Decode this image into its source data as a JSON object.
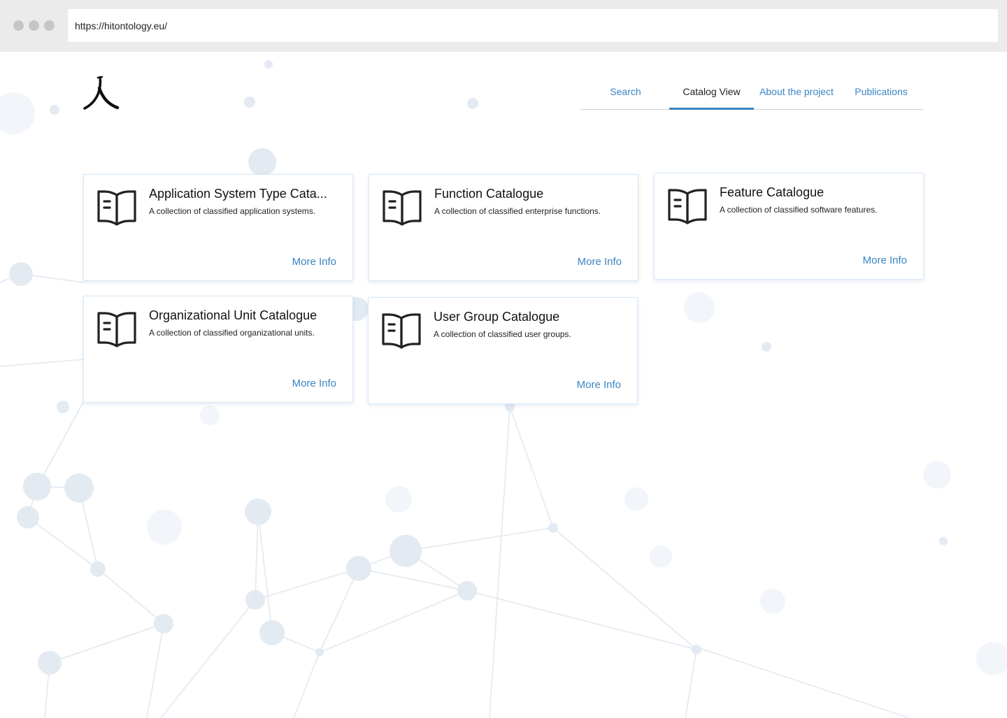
{
  "browser": {
    "url": "https://hitontology.eu/"
  },
  "header": {
    "logo_glyph": "人"
  },
  "nav": {
    "items": [
      {
        "label": "Search",
        "active": false
      },
      {
        "label": "Catalog View",
        "active": true
      },
      {
        "label": "About the project",
        "active": false
      },
      {
        "label": "Publications",
        "active": false
      }
    ]
  },
  "cards": [
    {
      "title": "Application System Type Cata...",
      "description": "A collection of classified application systems.",
      "link": "More Info",
      "icon": "open-book-icon"
    },
    {
      "title": "Function Catalogue",
      "description": "A collection of classified enterprise functions.",
      "link": "More Info",
      "icon": "open-book-icon"
    },
    {
      "title": "Feature Catalogue",
      "description": "A collection of classified software features.",
      "link": "More Info",
      "icon": "open-book-icon"
    },
    {
      "title": "Organizational Unit Catalogue",
      "description": "A collection of classified organizational units.",
      "link": "More Info",
      "icon": "open-book-icon"
    },
    {
      "title": "User Group Catalogue",
      "description": "A collection of classified user groups.",
      "link": "More Info",
      "icon": "open-book-icon"
    }
  ],
  "colors": {
    "accent": "#3a85c4",
    "card_border": "#d7e8f6",
    "chrome": "#ebebeb"
  }
}
